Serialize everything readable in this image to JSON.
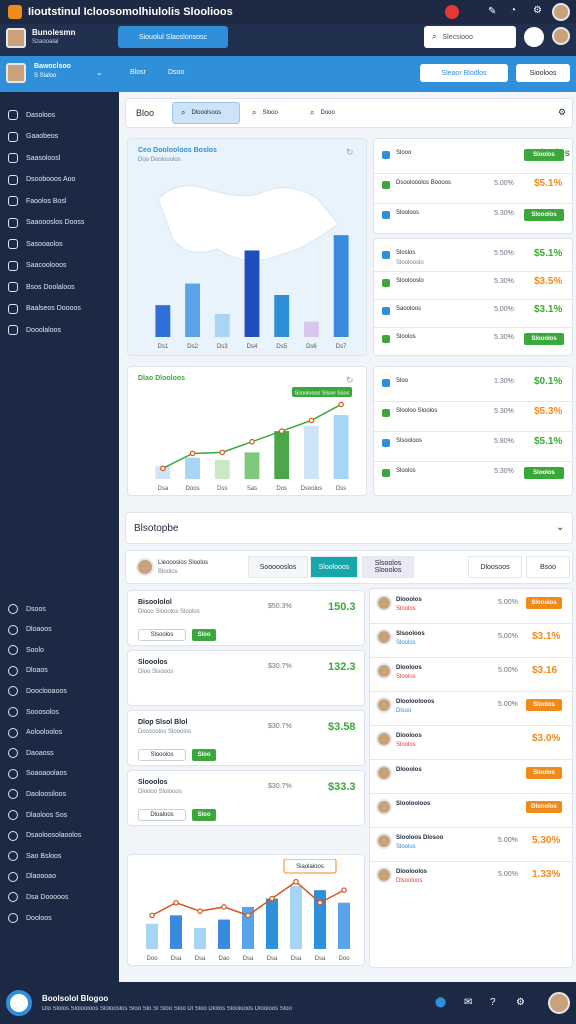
{
  "app": {
    "title": "Iioutstinul Icloosomolhiulolis Sloolioos",
    "user_name": "Bunolesmn",
    "user_sub": "Szaooalal",
    "search_btn": "Siouolul Slaoslonsosc"
  },
  "header": {
    "search_placeholder": "Slecsiooo",
    "profile_name": "Bawoclsoo",
    "profile_sub": "S Slaloo",
    "nav1": "Blosr",
    "nav2": "Dsoo",
    "cta": "Sleaor Blodlos",
    "btn2": "Siooloos"
  },
  "sidebar": {
    "items": [
      "Dasoloos",
      "Gaaobeos",
      "Saasoloosl",
      "Dsoobooos Aoo",
      "Faoolos Bosl",
      "Saaoooslos Dooss",
      "Sasooaolos",
      "Saacoolooos",
      "Bsos Doolaloos",
      "Baalseos Doooos",
      "Dooolaloos"
    ],
    "items2": [
      "Dsoos",
      "Dloaoos",
      "Soolo",
      "Dloaos",
      "Dooclooaoos",
      "Sooosolos",
      "Aolooloolos",
      "Daoaoss",
      "Soaoaoolaos",
      "Daoloosiloos",
      "Dlaoloos Sos",
      "Dsaoloosolaoolos",
      "Sao Bsloos",
      "Dlaoooao",
      "Dsa Dooooos",
      "Dooloos"
    ]
  },
  "filters": {
    "label": "Bloo",
    "tab1": "Dlooolsoos",
    "tab2": "Slooo",
    "tab3": "Dooo"
  },
  "map_chart": {
    "title": "Ceo Doolooloos Boslos",
    "subtitle": "Doo Doolooolos"
  },
  "chart_data": [
    {
      "type": "bar",
      "title": "",
      "categories": [
        "Ds1",
        "Ds2",
        "Ds3",
        "Ds4",
        "Ds5",
        "Ds6",
        "Ds7"
      ],
      "series": [
        {
          "name": "",
          "values": [
            25,
            42,
            18,
            68,
            33,
            12,
            80
          ]
        }
      ]
    },
    {
      "type": "bar",
      "title": "Dlao Dlooloos",
      "categories": [
        "Dsa",
        "Doos",
        "Dss",
        "Sas",
        "Dos",
        "Dsoolos",
        "Dss"
      ],
      "series": [
        {
          "name": "",
          "values": [
            12,
            20,
            18,
            25,
            45,
            50,
            60
          ]
        }
      ],
      "line": [
        10,
        24,
        25,
        35,
        45,
        55,
        70
      ],
      "badge": "Ssoolooos Slsoo Ssos"
    },
    {
      "type": "bar",
      "title": "",
      "categories": [
        "Doo",
        "Dsa",
        "Dsa",
        "Dao",
        "Dsa",
        "Dsa",
        "Dsa",
        "Dsa",
        "Doo"
      ],
      "series": [
        {
          "name": "",
          "values": [
            30,
            40,
            25,
            35,
            50,
            60,
            75,
            70,
            55
          ]
        }
      ],
      "line": [
        40,
        55,
        45,
        50,
        40,
        60,
        80,
        55,
        70
      ],
      "tooltip": "Siaolaloos"
    }
  ],
  "right_list_a": [
    {
      "name": "Slooo",
      "pct": "",
      "value": "Sloolos",
      "btn": "Sloolos"
    },
    {
      "name": "Dsoolooolos Boooos",
      "pct": "5.00%",
      "value": "$5.1%",
      "btn": ""
    },
    {
      "name": "Slooloos",
      "pct": "5.30%",
      "value": "",
      "btn": "Slooolos"
    }
  ],
  "right_list_b": [
    {
      "name": "Sloslos",
      "sub": "Sloolooslo",
      "pct": "5.50%",
      "value": "$5.1%",
      "btn": ""
    },
    {
      "name": "Sloolooslo",
      "sub": "",
      "pct": "5.30%",
      "value": "$3.5%",
      "btn": ""
    },
    {
      "name": "Saooloos",
      "sub": "",
      "pct": "5.00%",
      "value": "$3.1%",
      "btn": ""
    },
    {
      "name": "Sloolos",
      "sub": "",
      "pct": "5.30%",
      "value": "",
      "btn": "Slooolos"
    }
  ],
  "right_list_c": [
    {
      "name": "Sloo",
      "pct": "1.30%",
      "value": "$0.1%"
    },
    {
      "name": "Slooloo Sloolos",
      "pct": "5.30%",
      "value": "$5.3%"
    },
    {
      "name": "Slsooloos",
      "pct": "5.80%",
      "value": "$5.1%"
    },
    {
      "name": "Sloolos",
      "pct": "5.30%",
      "value": "",
      "btn": "Sloolos"
    }
  ],
  "section2": {
    "title": "Blsotopbe",
    "user": "Lleoooslos Sloolos",
    "user_sub": "Bloolos",
    "tab1": "Soooooslos",
    "tab2": "Sloolooos",
    "tab3": "Slsoolos",
    "tab4": "Slooolos",
    "tab5": "Dloosoos",
    "tab6": "Bsoo"
  },
  "deals": [
    {
      "title": "Bisoololol",
      "sub": "Dlooo Slooolos Sloolos",
      "pct": "$50.3%",
      "value": "150.3",
      "btn": "Slsoolos",
      "tag": "Sloo"
    },
    {
      "title": "Slooolos",
      "sub": "Dloo Slsooos",
      "pct": "$30.7%",
      "value": "132.3",
      "btn": "",
      "tag": ""
    },
    {
      "title": "Dlop Slsol Blol",
      "sub": "Doosoolos Slooolos",
      "pct": "$30.7%",
      "value": "$3.58",
      "btn": "Slooolos",
      "tag": "Sloo"
    },
    {
      "title": "Slooolos",
      "sub": "Dloooo Slolooos",
      "pct": "$30.7%",
      "value": "$33.3",
      "btn": "Dloaloos",
      "tag": "Sloo"
    }
  ],
  "people": [
    {
      "name": "Dlooolos",
      "sub": "Sloolos",
      "pct": "5.00%",
      "value": "$3.1%",
      "btn": "Slooolos"
    },
    {
      "name": "Slsooloos",
      "sub": "Sloolos",
      "pct": "5.00%",
      "value": "$3.1%"
    },
    {
      "name": "Dlooloos",
      "sub": "Sloolos",
      "pct": "5.00%",
      "value": "$3.16"
    },
    {
      "name": "Dlooloolooos",
      "sub": "Dlsoo",
      "pct": "5.00%",
      "value": "",
      "btn": "Sloolos"
    },
    {
      "name": "Dlooloos",
      "sub": "Sloolos",
      "pct": "",
      "value": "$3.0%"
    },
    {
      "name": "Dlooolos",
      "sub": "",
      "pct": "",
      "value": "",
      "btn": "Sloolos"
    },
    {
      "name": "Sloolooloos",
      "sub": "",
      "pct": "",
      "value": "",
      "btn": "Dlooolos"
    },
    {
      "name": "Slooloos Dlosoo",
      "sub": "Sloolos",
      "pct": "5.00%",
      "value": "5.30%"
    },
    {
      "name": "Dlooloolos",
      "sub": "Dlsooloos",
      "pct": "5.00%",
      "value": "1.33%"
    }
  ],
  "footer": {
    "name": "Boolsolol Blogoo",
    "sub": "Dlo Slolos Slolooloos Slolooslos Sloo Slo Sl Sloo Sloo Dl Sloo Dlolos Sloolooos Dlooloos Sloo"
  },
  "colors": {
    "accent": "#2f8fd8",
    "green": "#3aa83a",
    "orange": "#f28a1a",
    "teal": "#18a7a8"
  }
}
